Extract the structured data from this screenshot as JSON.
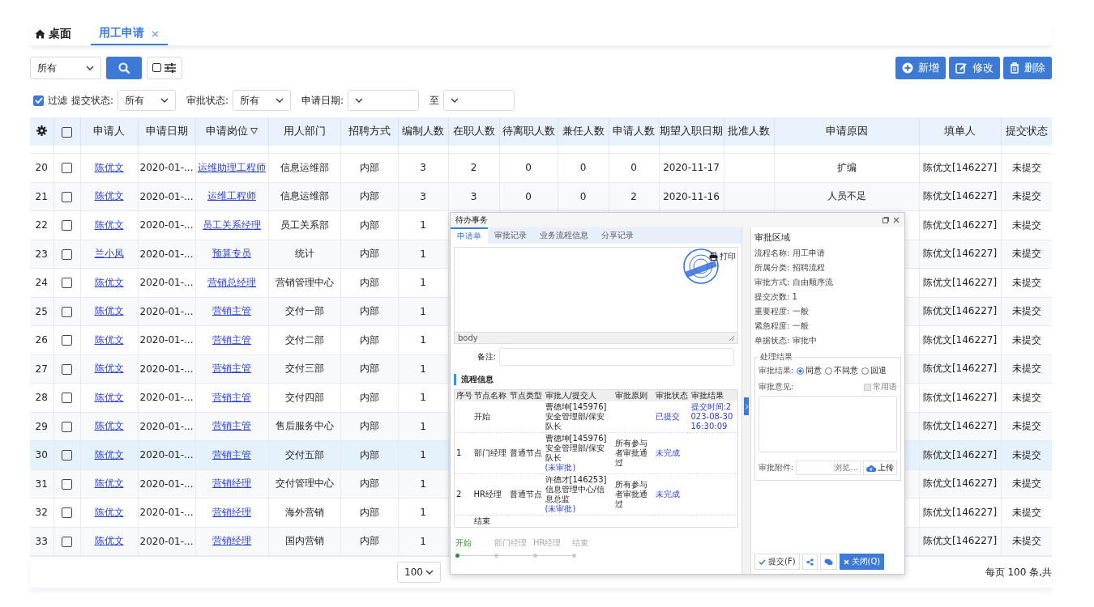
{
  "tabs": [
    {
      "label": "桌面",
      "kind": "home",
      "selected": false
    },
    {
      "label": "用工申请",
      "kind": "page",
      "selected": true,
      "close": "×"
    }
  ],
  "toolbar": {
    "scope": "所有",
    "actions": [
      {
        "label": "新增",
        "kind": "add"
      },
      {
        "label": "修改",
        "kind": "edit"
      },
      {
        "label": "删除",
        "kind": "delete"
      }
    ]
  },
  "filter": {
    "enabled": true,
    "label": "过滤",
    "fields": [
      {
        "label": "提交状态:",
        "value": "所有"
      },
      {
        "label": "审批状态:",
        "value": "所有"
      },
      {
        "label": "申请日期:"
      },
      {
        "label": "至"
      }
    ]
  },
  "table": {
    "columns": [
      {
        "label": "申请人",
        "kind": "link",
        "filterable": false
      },
      {
        "label": "申请日期",
        "kind": "text",
        "filterable": false
      },
      {
        "label": "申请岗位",
        "kind": "link",
        "filterable": true
      },
      {
        "label": "用人部门",
        "kind": "text",
        "filterable": false
      },
      {
        "label": "招聘方式",
        "kind": "text",
        "filterable": false
      },
      {
        "label": "编制人数",
        "kind": "text",
        "filterable": false
      },
      {
        "label": "在职人数",
        "kind": "text",
        "filterable": false
      },
      {
        "label": "待离职人数",
        "kind": "text",
        "filterable": false
      },
      {
        "label": "兼任人数",
        "kind": "text",
        "filterable": false
      },
      {
        "label": "申请人数",
        "kind": "text",
        "filterable": false
      },
      {
        "label": "期望入职日期",
        "kind": "text",
        "filterable": false
      },
      {
        "label": "批准人数",
        "filterable": false
      },
      {
        "label": "申请原因",
        "kind": "text",
        "filterable": false
      },
      {
        "label": "填单人",
        "kind": "text",
        "filterable": false
      },
      {
        "label": "提交状态",
        "kind": "text",
        "filterable": false
      }
    ],
    "all_checked": false,
    "rows": [
      {
        "no": "20",
        "checked": false,
        "selected": false,
        "cells": [
          "陈优文",
          "2020-01-...",
          "运维助理工程师",
          "信息运维部",
          "内部",
          "3",
          "2",
          "0",
          "0",
          "0",
          "2020-11-17"
        ],
        "tail": [
          "扩编",
          "陈优文[146227]",
          "未提交"
        ]
      },
      {
        "no": "21",
        "checked": false,
        "selected": false,
        "cells": [
          "陈优文",
          "2020-01-...",
          "运维工程师",
          "信息运维部",
          "内部",
          "3",
          "3",
          "0",
          "0",
          "2",
          "2020-11-16"
        ],
        "tail": [
          "人员不足",
          "陈优文[146227]",
          "未提交"
        ]
      },
      {
        "no": "22",
        "checked": false,
        "selected": false,
        "cells": [
          "陈优文",
          "2020-01-...",
          "员工关系经理",
          "员工关系部",
          "内部",
          "1"
        ],
        "tail": [
          "陈优文[146227]",
          "未提交"
        ]
      },
      {
        "no": "23",
        "checked": false,
        "selected": false,
        "cells": [
          "兰小凤",
          "2020-01-...",
          "预算专员",
          "统计",
          "内部",
          "1"
        ],
        "tail": [
          "陈优文[146227]",
          "未提交"
        ]
      },
      {
        "no": "24",
        "checked": false,
        "selected": false,
        "cells": [
          "陈优文",
          "2020-01-...",
          "营销总经理",
          "营销管理中心",
          "内部",
          "1"
        ],
        "tail": [
          "陈优文[146227]",
          "未提交"
        ]
      },
      {
        "no": "25",
        "checked": false,
        "selected": false,
        "cells": [
          "陈优文",
          "2020-01-...",
          "营销主管",
          "交付一部",
          "内部",
          "1"
        ],
        "tail": [
          "陈优文[146227]",
          "未提交"
        ]
      },
      {
        "no": "26",
        "checked": false,
        "selected": false,
        "cells": [
          "陈优文",
          "2020-01-...",
          "营销主管",
          "交付二部",
          "内部",
          "1"
        ],
        "tail": [
          "陈优文[146227]",
          "未提交"
        ]
      },
      {
        "no": "27",
        "checked": false,
        "selected": false,
        "cells": [
          "陈优文",
          "2020-01-...",
          "营销主管",
          "交付三部",
          "内部",
          "1"
        ],
        "tail": [
          "陈优文[146227]",
          "未提交"
        ]
      },
      {
        "no": "28",
        "checked": false,
        "selected": false,
        "cells": [
          "陈优文",
          "2020-01-...",
          "营销主管",
          "交付四部",
          "内部",
          "1"
        ],
        "tail": [
          "陈优文[146227]",
          "未提交"
        ]
      },
      {
        "no": "29",
        "checked": false,
        "selected": false,
        "cells": [
          "陈优文",
          "2020-01-...",
          "营销主管",
          "售后服务中心",
          "内部",
          "1"
        ],
        "tail": [
          "陈优文[146227]",
          "未提交"
        ]
      },
      {
        "no": "30",
        "checked": false,
        "selected": true,
        "cells": [
          "陈优文",
          "2020-01-...",
          "营销主管",
          "交付五部",
          "内部",
          "1"
        ],
        "tail": [
          "陈优文[146227]",
          "未提交"
        ]
      },
      {
        "no": "31",
        "checked": false,
        "selected": false,
        "cells": [
          "陈优文",
          "2020-01-...",
          "营销经理",
          "交付管理中心",
          "内部",
          "1"
        ],
        "tail": [
          "陈优文[146227]",
          "未提交"
        ]
      },
      {
        "no": "32",
        "checked": false,
        "selected": false,
        "cells": [
          "陈优文",
          "2020-01-...",
          "营销经理",
          "海外营销",
          "内部",
          "1"
        ],
        "tail": [
          "陈优文[146227]",
          "未提交"
        ]
      },
      {
        "no": "33",
        "checked": false,
        "selected": false,
        "cells": [
          "陈优文",
          "2020-01-...",
          "营销经理",
          "国内营销",
          "内部",
          "1"
        ],
        "tail": [
          "陈优文[146227]",
          "未提交"
        ]
      }
    ]
  },
  "pager": {
    "page_size": "100",
    "summary": "每页 100 条,共"
  },
  "dialog": {
    "title": "待办事务",
    "tabs": [
      {
        "label": "申请单",
        "selected": true
      },
      {
        "label": "审批记录",
        "selected": false
      },
      {
        "label": "业务流程信息",
        "selected": false
      },
      {
        "label": "分享记录",
        "selected": false
      }
    ],
    "print": "打印",
    "editor_status": "body",
    "remark_label": "备注:",
    "flow_heading": "流程信息",
    "flow_columns": [
      "序号",
      "节点名称",
      "节点类型",
      "审批人/提交人",
      "审批原则",
      "审批状态",
      "审批结果"
    ],
    "flow_rows": [
      {
        "node": "开始",
        "approver": "曹德坤[145976]安全管理部/保安队长",
        "status": "已提交",
        "result": "提交时间:2023-08-30 16:30:09"
      },
      {
        "no": "1",
        "node": "部门经理",
        "type": "普通节点",
        "approver": "曹德坤[145976]安全管理部/保安队长",
        "approver_note": "(未审批)",
        "rule": "所有参与者审批通过",
        "status": "未完成"
      },
      {
        "no": "2",
        "node": "HR经理",
        "type": "普通节点",
        "approver": "许德才[146253]信息管理中心/信息总监",
        "approver_note": "(未审批)",
        "rule": "所有参与者审批通过",
        "status": "未完成"
      },
      {
        "node": "结束"
      }
    ],
    "steps": [
      {
        "label": "开始",
        "done": true
      },
      {
        "label": "部门经理",
        "done": false
      },
      {
        "label": "HR经理",
        "done": false
      },
      {
        "label": "结束",
        "done": false
      }
    ],
    "panel": {
      "heading": "审批区域",
      "info": [
        {
          "label": "流程名称:",
          "value": "用工申请"
        },
        {
          "label": "所属分类:",
          "value": "招聘流程"
        },
        {
          "label": "审批方式:",
          "value": "自由顺序流"
        },
        {
          "label": "提交次数:",
          "value": "1"
        },
        {
          "label": "重要程度:",
          "value": "一般"
        },
        {
          "label": "紧急程度:",
          "value": "一般"
        },
        {
          "label": "单据状态:",
          "value": "审批中"
        }
      ],
      "legend": "处理结果",
      "result_label": "审批结果:",
      "options": [
        {
          "label": "同意",
          "selected": true
        },
        {
          "label": "不同意",
          "selected": false
        },
        {
          "label": "回退",
          "selected": false
        }
      ],
      "opinion_label": "审批意见:",
      "phrases": {
        "label": "常用语",
        "checked": false
      },
      "attach_label": "审批附件:",
      "browse": "浏览...",
      "upload": "上传"
    },
    "buttons": [
      {
        "label": "提交(F)",
        "kind": "submit"
      },
      {
        "kind": "share"
      },
      {
        "kind": "comment"
      },
      {
        "label": "关闭(Q)",
        "kind": "close"
      }
    ]
  }
}
